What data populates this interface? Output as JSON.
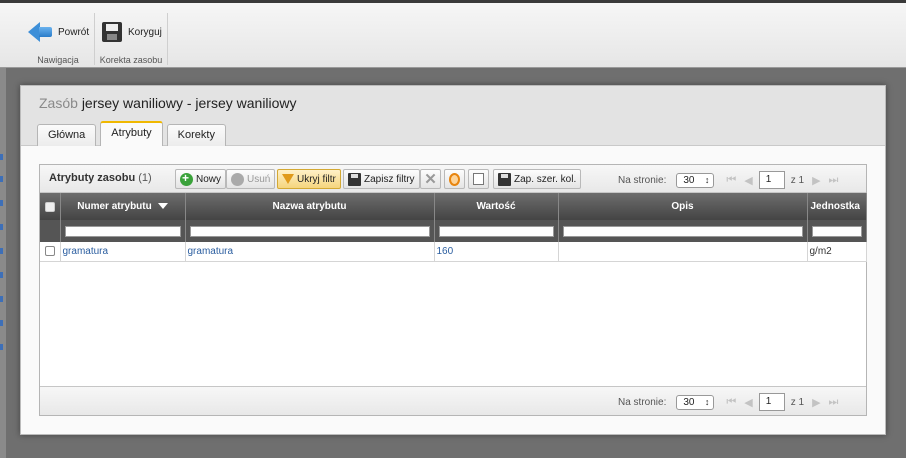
{
  "toolbar": {
    "back_label": "Powrót",
    "nav_caption": "Nawigacja",
    "edit_label": "Koryguj",
    "edit_caption": "Korekta zasobu"
  },
  "dialog": {
    "title_prefix": "Zasób",
    "title": "jersey waniliowy - jersey waniliowy",
    "tabs": [
      "Główna",
      "Atrybuty",
      "Korekty"
    ],
    "active_tab": "Atrybuty"
  },
  "grid": {
    "title": "Atrybuty zasobu",
    "count": "(1)",
    "buttons": {
      "new": "Nowy",
      "delete": "Usuń",
      "hide_filter": "Ukryj filtr",
      "save_filters": "Zapisz filtry",
      "save_widths": "Zap. szer. kol."
    },
    "pager": {
      "per_page_label": "Na stronie:",
      "per_page": "30",
      "page": "1",
      "of": "z 1"
    },
    "columns": [
      "Numer atrybutu",
      "Nazwa atrybutu",
      "Wartość",
      "Opis",
      "Jednostka"
    ],
    "rows": [
      {
        "number": "gramatura",
        "name": "gramatura",
        "value": "160",
        "desc": "",
        "unit": "g/m2"
      }
    ]
  }
}
